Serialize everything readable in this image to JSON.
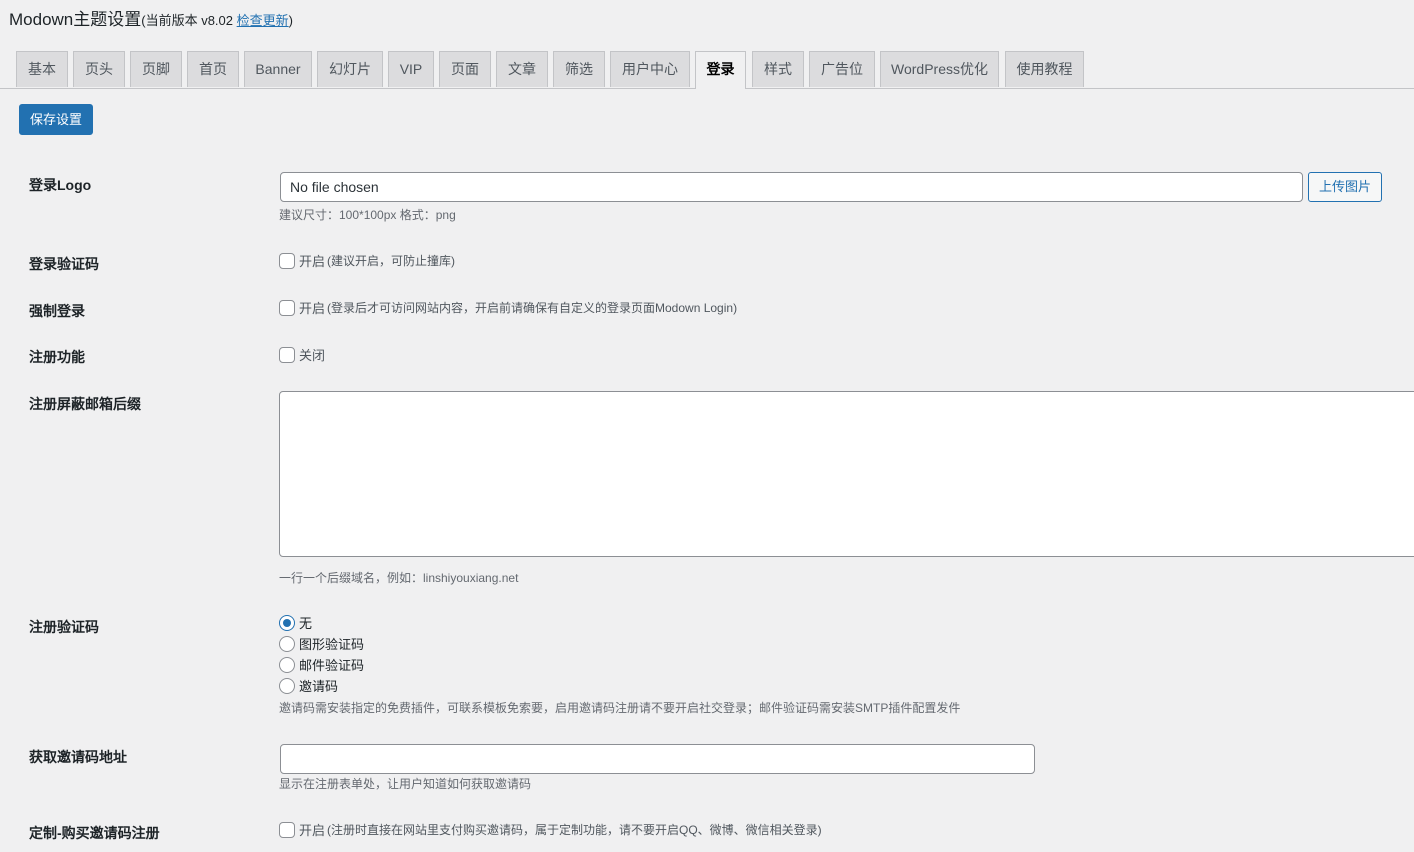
{
  "header": {
    "title": "Modown主题设置",
    "version_prefix": "(当前版本 v8.02 ",
    "check_update": "检查更新",
    "version_suffix": ")"
  },
  "tabs": [
    {
      "label": "基本"
    },
    {
      "label": "页头"
    },
    {
      "label": "页脚"
    },
    {
      "label": "首页"
    },
    {
      "label": "Banner"
    },
    {
      "label": "幻灯片"
    },
    {
      "label": "VIP"
    },
    {
      "label": "页面"
    },
    {
      "label": "文章"
    },
    {
      "label": "筛选"
    },
    {
      "label": "用户中心"
    },
    {
      "label": "登录",
      "active": true
    },
    {
      "label": "样式"
    },
    {
      "label": "广告位"
    },
    {
      "label": "WordPress优化"
    },
    {
      "label": "使用教程"
    }
  ],
  "toolbar": {
    "save_label": "保存设置"
  },
  "settings": {
    "login_logo": {
      "label": "登录Logo",
      "file_value": "No file chosen",
      "upload_label": "上传图片",
      "desc": "建议尺寸：100*100px 格式：png"
    },
    "login_captcha": {
      "label": "登录验证码",
      "checked": false,
      "option": "开启",
      "hint": "(建议开启，可防止撞库)"
    },
    "force_login": {
      "label": "强制登录",
      "checked": false,
      "option": "开启",
      "hint": "(登录后才可访问网站内容，开启前请确保有自定义的登录页面Modown Login)"
    },
    "register": {
      "label": "注册功能",
      "checked": false,
      "option": "关闭"
    },
    "blocked_suffix": {
      "label": "注册屏蔽邮箱后缀",
      "value": "",
      "desc": "一行一个后缀域名，例如：linshiyouxiang.net"
    },
    "register_captcha": {
      "label": "注册验证码",
      "options": [
        {
          "label": "无",
          "checked": true
        },
        {
          "label": "图形验证码",
          "checked": false
        },
        {
          "label": "邮件验证码",
          "checked": false
        },
        {
          "label": "邀请码",
          "checked": false
        }
      ],
      "desc": "邀请码需安装指定的免费插件，可联系模板免索要，启用邀请码注册请不要开启社交登录；邮件验证码需安装SMTP插件配置发件"
    },
    "invite_url": {
      "label": "获取邀请码地址",
      "value": "",
      "desc": "显示在注册表单处，让用户知道如何获取邀请码"
    },
    "buy_invite": {
      "label": "定制-购买邀请码注册",
      "checked": false,
      "option": "开启",
      "hint": "(注册时直接在网站里支付购买邀请码，属于定制功能，请不要开启QQ、微博、微信相关登录)"
    }
  }
}
